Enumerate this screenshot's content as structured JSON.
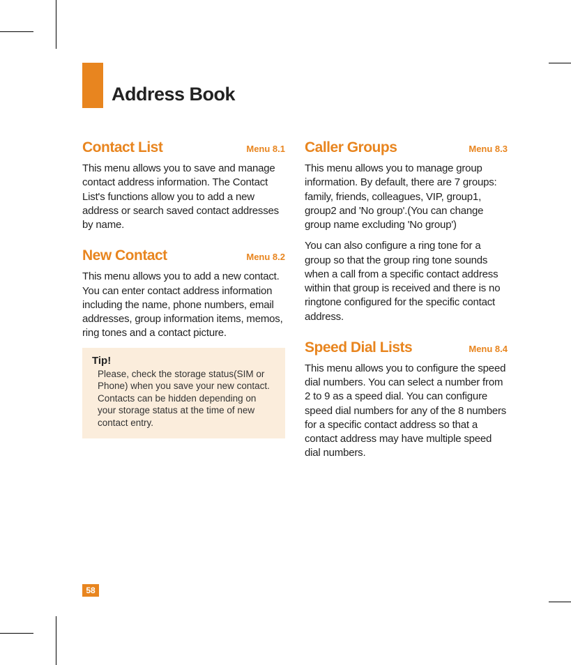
{
  "page_number": "58",
  "chapter_title": "Address Book",
  "left": {
    "s1": {
      "title": "Contact List",
      "menu": "Menu 8.1",
      "body": "This menu allows you to save and manage contact address information. The Contact List's functions allow you to add a new address or search saved contact addresses by name."
    },
    "s2": {
      "title": "New Contact",
      "menu": "Menu 8.2",
      "body": "This menu allows you to add a new contact. You can enter contact address information including the name, phone numbers, email addresses, group information items, memos, ring tones and a contact picture."
    },
    "tip": {
      "title": "Tip!",
      "body": "Please, check the storage status(SIM or Phone) when you save your new contact. Contacts can be hidden depending on your storage status at the time of new contact entry."
    }
  },
  "right": {
    "s1": {
      "title": "Caller Groups",
      "menu": "Menu 8.3",
      "body1": "This menu allows you to manage group information. By default, there are 7 groups: family, friends, colleagues, VIP, group1, group2 and 'No group'.(You can change group name excluding 'No group')",
      "body2": "You can also configure a ring tone for a group so that the group ring tone sounds when a call from a specific contact address within that group is received and there is no ringtone configured for the specific contact address."
    },
    "s2": {
      "title": "Speed Dial Lists",
      "menu": "Menu 8.4",
      "body": "This menu allows you to configure the speed dial numbers. You can select a number from 2 to 9 as a speed dial. You can configure speed dial numbers for any of the 8 numbers for a specific contact address so that a contact address may have multiple speed dial numbers."
    }
  }
}
